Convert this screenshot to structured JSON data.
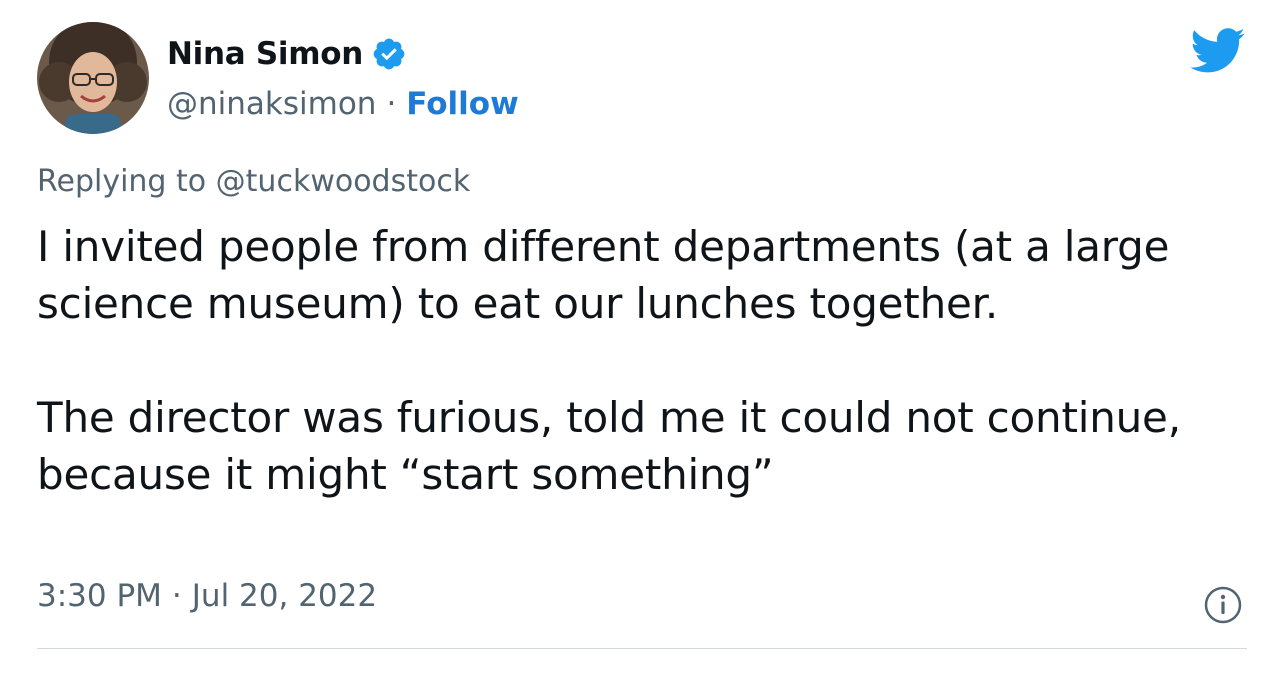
{
  "author": {
    "display_name": "Nina Simon",
    "handle": "@ninaksimon",
    "separator": "·",
    "follow_label": "Follow",
    "verified": true,
    "avatar_icon": "profile-photo"
  },
  "reply": {
    "prefix": "Replying to ",
    "to_handle": "@tuckwoodstock"
  },
  "tweet": {
    "paragraphs": [
      "I invited people from different departments (at a large science museum) to eat our lunches together.",
      "The director was furious, told me it could not continue, because it might “start something”"
    ]
  },
  "meta": {
    "time": "3:30 PM",
    "separator": "·",
    "date": "Jul 20, 2022"
  },
  "icons": {
    "logo": "twitter-bird-icon",
    "info": "info-icon",
    "verified": "verified-badge-icon"
  },
  "colors": {
    "brand_blue": "#1d9bf0",
    "follow_blue": "#1d7ad6",
    "secondary_text": "#536471",
    "primary_text": "#0f1419"
  }
}
